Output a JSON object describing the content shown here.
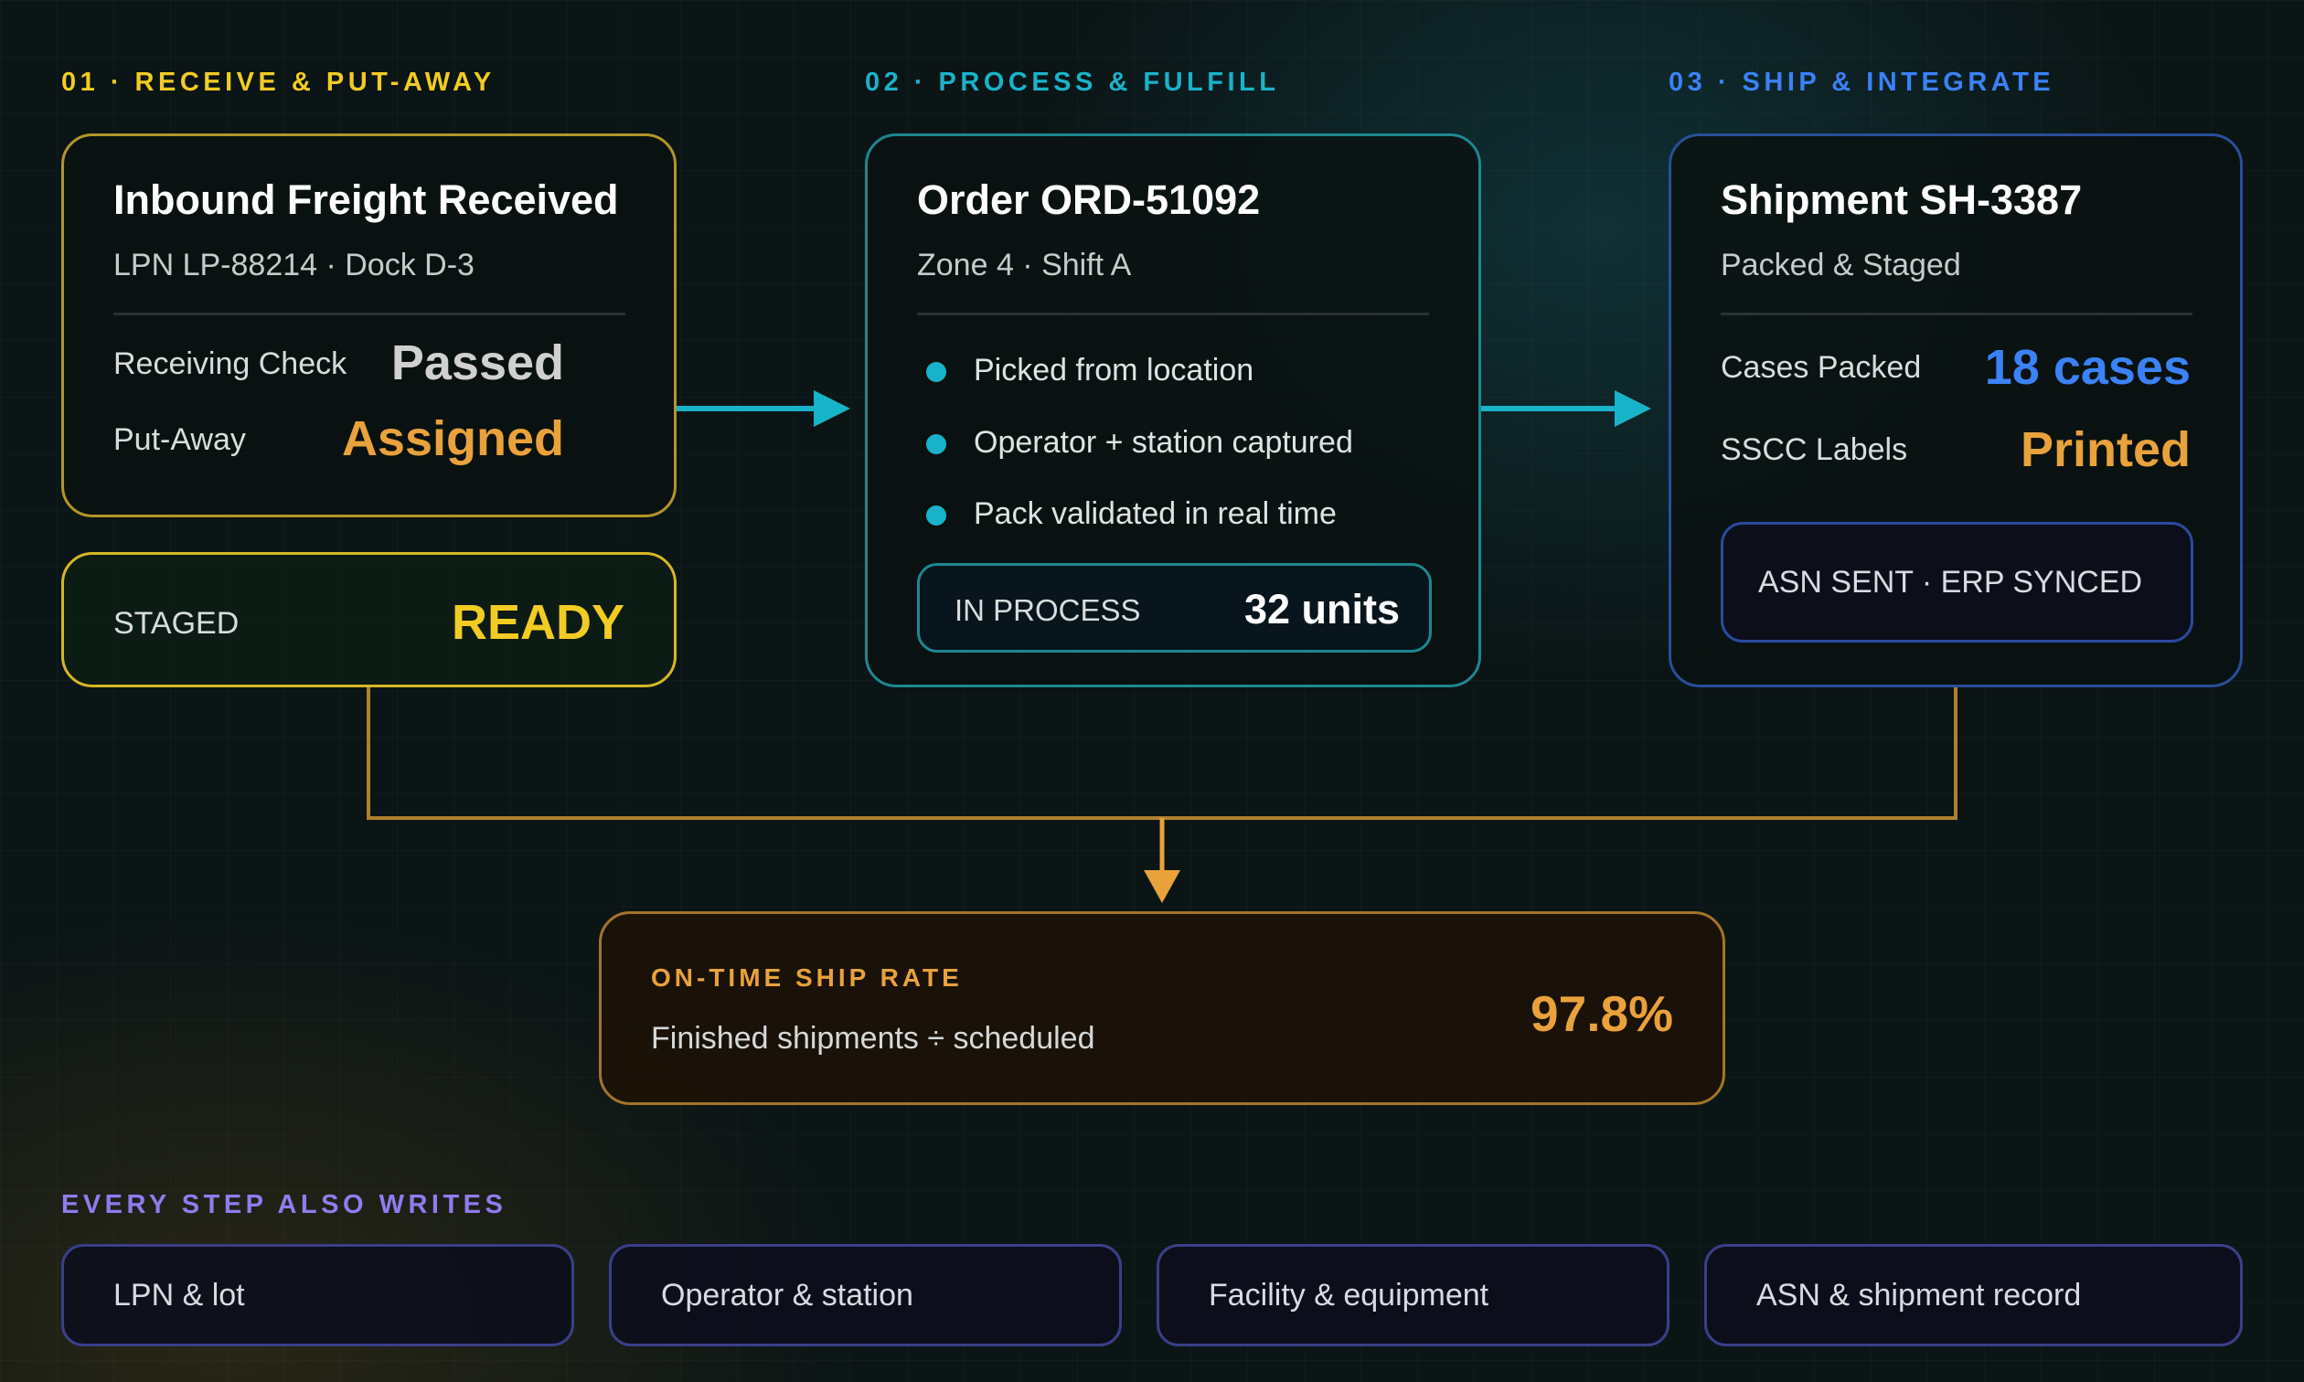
{
  "colors": {
    "gold": "#f2cc22",
    "teal": "#19b3c9",
    "blue": "#3b82f6",
    "orange": "#e9a23b",
    "purple": "#8f7cf0",
    "grey_value": "#d0d0d0"
  },
  "phases": [
    {
      "label": "01 · RECEIVE & PUT-AWAY"
    },
    {
      "label": "02 · PROCESS & FULFILL"
    },
    {
      "label": "03 · SHIP & INTEGRATE"
    }
  ],
  "receive": {
    "title": "Inbound Freight Received",
    "subtitle": "LPN LP-88214 · Dock D-3",
    "rows": [
      {
        "label": "Receiving Check",
        "value": "Passed"
      },
      {
        "label": "Put-Away",
        "value": "Assigned"
      }
    ],
    "status": {
      "label": "STAGED",
      "value": "READY"
    }
  },
  "process": {
    "title": "Order ORD-51092",
    "subtitle": "Zone 4 · Shift A",
    "bullets": [
      "Picked from location",
      "Operator + station captured",
      "Pack validated in real time"
    ],
    "status": {
      "label": "IN PROCESS",
      "value": "32 units"
    }
  },
  "ship": {
    "title": "Shipment SH-3387",
    "subtitle": "Packed & Staged",
    "rows": [
      {
        "label": "Cases Packed",
        "value": "18 cases"
      },
      {
        "label": "SSCC Labels",
        "value": "Printed"
      }
    ],
    "tag": "ASN SENT · ERP SYNCED"
  },
  "metric": {
    "label": "ON-TIME SHIP RATE",
    "formula": "Finished shipments ÷ scheduled",
    "value": "97.8%"
  },
  "writes": {
    "heading": "EVERY STEP ALSO WRITES",
    "items": [
      "LPN & lot",
      "Operator & station",
      "Facility & equipment",
      "ASN & shipment record"
    ]
  }
}
